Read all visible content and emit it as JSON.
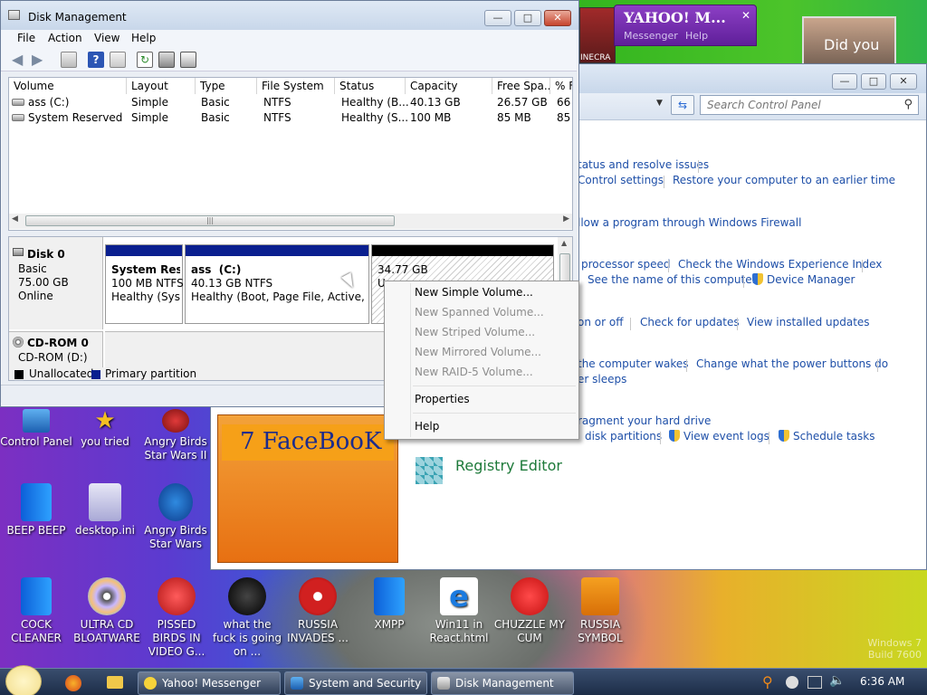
{
  "disk_mgmt": {
    "title": "Disk Management",
    "menu": [
      "File",
      "Action",
      "View",
      "Help"
    ],
    "columns": [
      "Volume",
      "Layout",
      "Type",
      "File System",
      "Status",
      "Capacity",
      "Free Spa...",
      "% F"
    ],
    "rows": [
      [
        "ass (C:)",
        "Simple",
        "Basic",
        "NTFS",
        "Healthy (B...",
        "40.13 GB",
        "26.57 GB",
        "66"
      ],
      [
        "System Reserved",
        "Simple",
        "Basic",
        "NTFS",
        "Healthy (S...",
        "100 MB",
        "85 MB",
        "85"
      ]
    ],
    "disk0": {
      "name": "Disk 0",
      "type": "Basic",
      "size": "75.00 GB",
      "status": "Online"
    },
    "partitions": [
      {
        "name": "System Reser",
        "size": "100 MB NTFS",
        "status": "Healthy (Syste"
      },
      {
        "name": "ass  (C:)",
        "size": "40.13 GB NTFS",
        "status": "Healthy (Boot, Page File, Active, Cra"
      },
      {
        "name": "34.77 GB",
        "status": "U"
      }
    ],
    "cdrom": {
      "name": "CD-ROM 0",
      "drive": "CD-ROM (D:)"
    },
    "legend": [
      "Unallocated",
      "Primary partition"
    ]
  },
  "context_menu": {
    "items": [
      {
        "label": "New Simple Volume...",
        "enabled": true
      },
      {
        "label": "New Spanned Volume...",
        "enabled": false
      },
      {
        "label": "New Striped Volume...",
        "enabled": false
      },
      {
        "label": "New Mirrored Volume...",
        "enabled": false
      },
      {
        "label": "New RAID-5 Volume...",
        "enabled": false
      },
      {
        "label": "Properties",
        "enabled": true
      },
      {
        "label": "Help",
        "enabled": true
      }
    ]
  },
  "control_panel": {
    "search_placeholder": "Search Control Panel",
    "links": {
      "l1": "tatus and resolve issues",
      "l2": "Control settings",
      "l3": "Restore your computer to an earlier time",
      "l4": "llow a program through Windows Firewall",
      "l5": "processor speed",
      "l6": "Check the Windows Experience Index",
      "l7": "See the name of this computer",
      "l8": "Device Manager",
      "l9": "on or off",
      "l10": "Check for updates",
      "l11": "View installed updates",
      "l12": "the computer wakes",
      "l13": "Change what the power buttons do",
      "l14": "er sleeps",
      "l15": "ragment your hard drive",
      "l16": "disk partitions",
      "l17": "View event logs",
      "l18": "Schedule tasks",
      "registry": "Registry Editor"
    }
  },
  "yahoo": {
    "logo": "YAHOO! M...",
    "sub1": "Messenger",
    "sub2": "Help"
  },
  "video_caption": "Did you",
  "minecraft_label": "INECRA",
  "facebook_label": "7 FaceBooK",
  "desktop_icons": [
    "Control Panel",
    "you tried",
    "Angry Birds Star Wars II",
    "BEEP BEEP",
    "desktop.ini",
    "Angry Birds Star Wars",
    "COCK CLEANER",
    "ULTRA CD BLOATWARE",
    "PISSED BIRDS IN VIDEO G...",
    "what the fuck is going on ...",
    "RUSSIA INVADES ...",
    "XMPP",
    "Win11 in React.html",
    "CHUZZLE MY CUM",
    "RUSSIA SYMBOL"
  ],
  "watermark": {
    "line1": "Windows 7",
    "line2": "Build 7600"
  },
  "taskbar": {
    "tasks": [
      "Yahoo! Messenger",
      "System and Security",
      "Disk Management"
    ],
    "clock": "6:36 AM"
  }
}
